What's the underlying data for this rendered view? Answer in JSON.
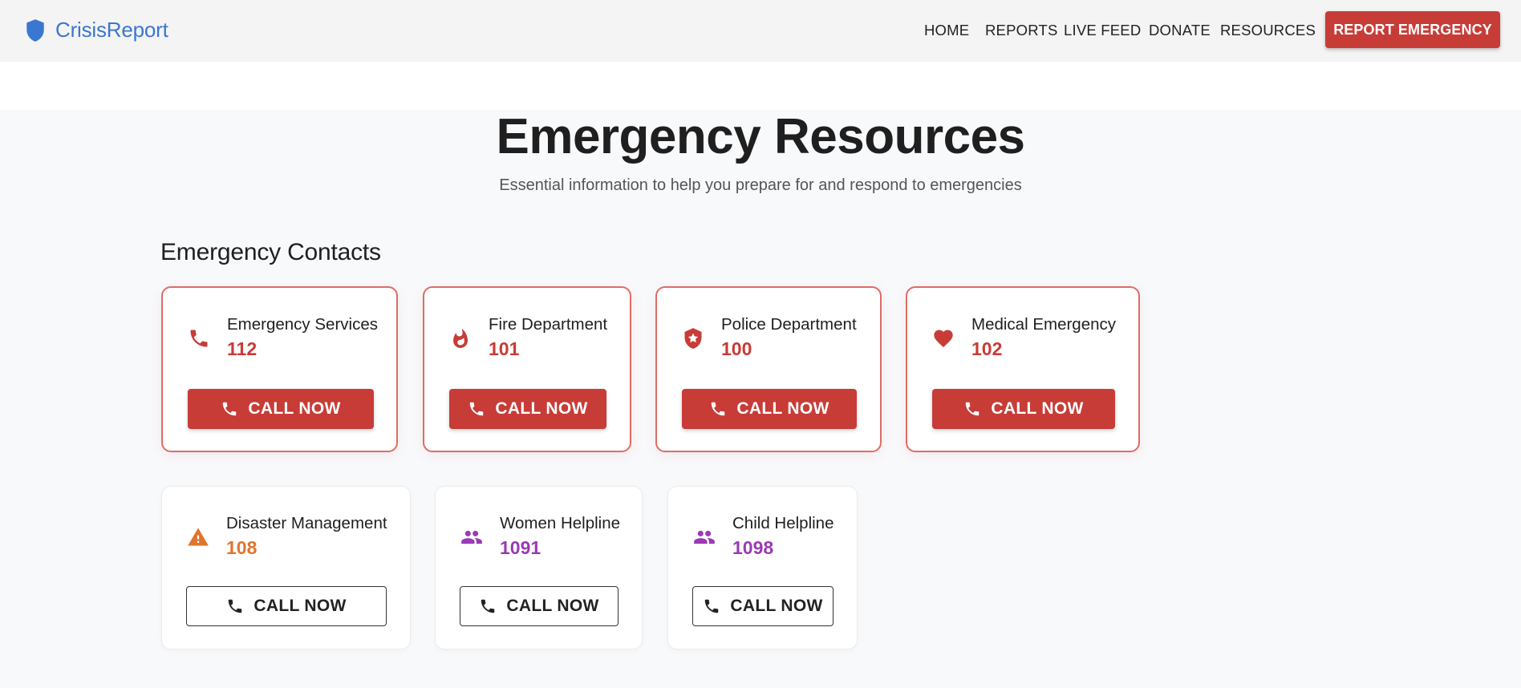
{
  "header": {
    "logo_text": "CrisisReport",
    "nav": [
      "HOME",
      "REPORTS",
      "LIVE FEED",
      "DONATE",
      "RESOURCES"
    ],
    "cta_label": "REPORT EMERGENCY"
  },
  "page": {
    "title": "Emergency Resources",
    "subtitle": "Essential information to help you prepare for and respond to emergencies"
  },
  "contacts": {
    "section_title": "Emergency Contacts",
    "call_label": "CALL NOW",
    "items": [
      {
        "name": "Emergency Services",
        "number": "112",
        "icon": "phone-icon",
        "color": "#c73c37",
        "style": "critical"
      },
      {
        "name": "Fire Department",
        "number": "101",
        "icon": "fire-icon",
        "color": "#c73c37",
        "style": "critical"
      },
      {
        "name": "Police Department",
        "number": "100",
        "icon": "police-badge-icon",
        "color": "#c73c37",
        "style": "critical"
      },
      {
        "name": "Medical Emergency",
        "number": "102",
        "icon": "heart-icon",
        "color": "#c73c37",
        "style": "critical"
      },
      {
        "name": "Disaster Management",
        "number": "108",
        "icon": "warning-icon",
        "color": "#e0742e",
        "style": "other"
      },
      {
        "name": "Women Helpline",
        "number": "1091",
        "icon": "people-icon",
        "color": "#9a3ab5",
        "style": "other"
      },
      {
        "name": "Child Helpline",
        "number": "1098",
        "icon": "people-icon",
        "color": "#9a3ab5",
        "style": "other"
      }
    ]
  },
  "colors": {
    "brand": "#3a77d0",
    "critical": "#c73c37",
    "warning": "#e0742e",
    "helpline": "#9a3ab5"
  }
}
